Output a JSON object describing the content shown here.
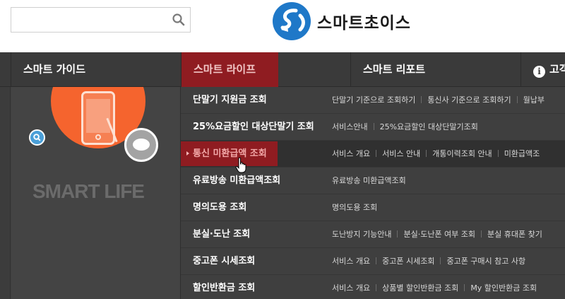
{
  "header": {
    "search_placeholder": "",
    "logo_text": "스마트초이스"
  },
  "nav": {
    "items": [
      {
        "label": "스마트 가이드"
      },
      {
        "label": "스마트 라이프"
      },
      {
        "label": "스마트 리포트"
      },
      {
        "label": "고객"
      }
    ],
    "active_index": 1
  },
  "left_panel": {
    "title": "SMART LIFE"
  },
  "rows": [
    {
      "title": "단말기 지원금 조회",
      "links": [
        "단말기 기준으로 조회하기",
        "통신사 기준으로 조회하기",
        "월납부"
      ]
    },
    {
      "title": "25%요금할인 대상단말기 조회",
      "links": [
        "서비스안내",
        "25%요금할인 대상단말기조회"
      ]
    },
    {
      "title": "통신 미환급액 조회",
      "links": [
        "서비스 개요",
        "서비스 안내",
        "개통이력조회 안내",
        "미환급액조"
      ]
    },
    {
      "title": "유료방송 미환급액조회",
      "links": [
        "유료방송 미환급액조회"
      ]
    },
    {
      "title": "명의도용 조회",
      "links": [
        "명의도용 조회"
      ]
    },
    {
      "title": "분실·도난 조회",
      "links": [
        "도난방지 기능안내",
        "분실·도난폰 여부 조회",
        "분실 휴대폰 찾기"
      ]
    },
    {
      "title": "중고폰 시세조회",
      "links": [
        "서비스 개요",
        "중고폰 시세조회",
        "중고폰 구매시 참고 사항"
      ]
    },
    {
      "title": "할인반환금 조회",
      "links": [
        "서비스 개요",
        "상품별 할인반환금 조회",
        "My 할인반환금 조회"
      ]
    }
  ],
  "highlighted_row_index": 2,
  "colors": {
    "accent_red": "#8f1c21",
    "hero_orange": "#f5642e",
    "logo_blue": "#1f78c8",
    "bg_dark": "#3f3f3f"
  },
  "icons": {
    "search": "search-icon",
    "info": "info-icon",
    "piggy": "piggy-bank-icon",
    "phone": "smartphone-icon",
    "cursor": "hand-pointer-icon"
  }
}
